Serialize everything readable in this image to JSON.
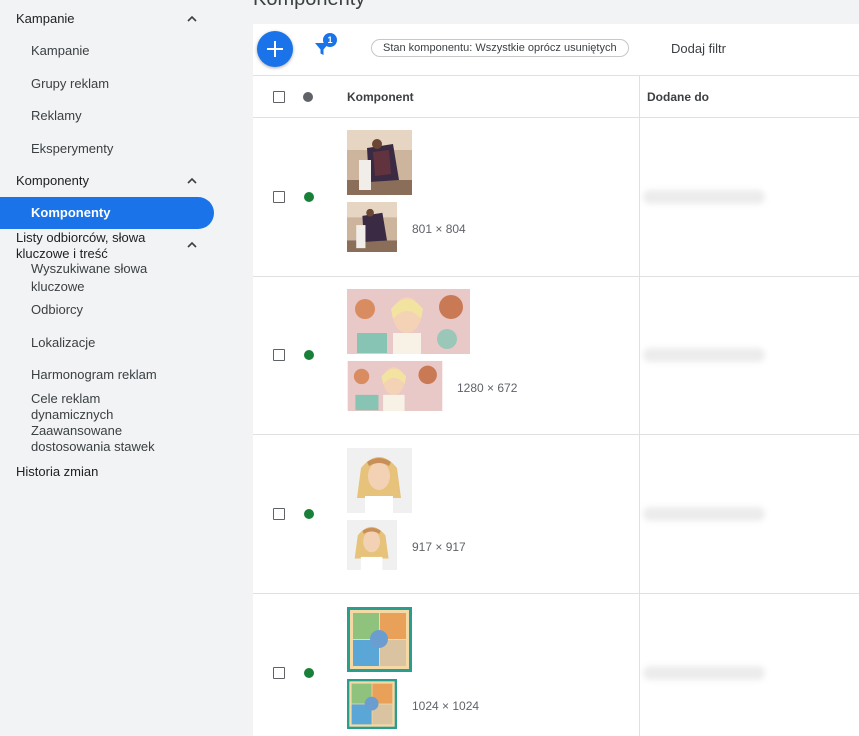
{
  "sidebar": {
    "sections": [
      {
        "label": "Kampanie",
        "items": [
          "Kampanie",
          "Grupy reklam",
          "Reklamy",
          "Eksperymenty"
        ]
      },
      {
        "label": "Komponenty",
        "items": [
          "Komponenty"
        ]
      },
      {
        "label_line1": "Listy odbiorców, słowa",
        "label_line2": "kluczowe i treść",
        "items": [
          "Wyszukiwane słowa",
          "kluczowe",
          "Odbiorcy",
          "Lokalizacje",
          "Harmonogram reklam",
          "Cele reklam",
          "dynamicznych",
          "Zaawansowane",
          "dostosowania stawek"
        ]
      },
      {
        "label": "Historia zmian"
      }
    ],
    "active_item": "Komponenty"
  },
  "main": {
    "title": "Komponenty",
    "toolbar": {
      "filter_count": "1",
      "filter_chip": "Stan komponentu: Wszystkie oprócz usuniętych",
      "add_filter": "Dodaj filtr"
    },
    "table": {
      "columns": [
        "Komponent",
        "Dodane do"
      ],
      "rows": [
        {
          "dimensions": "801 × 804",
          "status": "active"
        },
        {
          "dimensions": "1280 × 672",
          "status": "active"
        },
        {
          "dimensions": "917 × 917",
          "status": "active"
        },
        {
          "dimensions": "1024 × 1024",
          "status": "active"
        }
      ]
    }
  },
  "colors": {
    "accent": "#1a73e8",
    "status_active": "#188038",
    "status_header_dot": "#5f6368",
    "sidebar_bg": "#f1f3f4"
  },
  "icons": [
    "chevron-up-icon",
    "add-icon",
    "filter-icon",
    "status-dot-icon"
  ]
}
